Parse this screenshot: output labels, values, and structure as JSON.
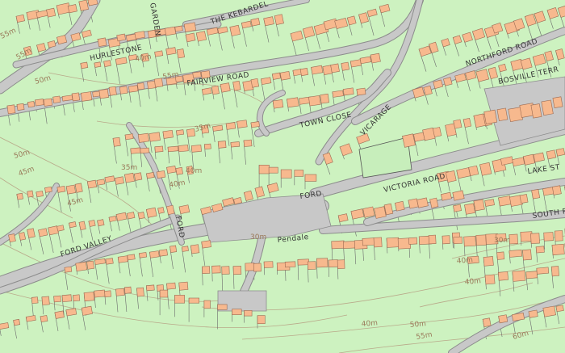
{
  "map": {
    "colors": {
      "land": "#cdf2c0",
      "road": "#c8c8c8",
      "road_edge": "#8c8c8c",
      "building": "#f7b98e",
      "plot_line": "#6b6b6b",
      "contour": "#b9a98a",
      "label": "#333333"
    },
    "street_labels": [
      "THE  KEBARDEL",
      "GARDEN",
      "HURLESTONE",
      "FAIRVIEW ROAD",
      "TOWN  CLOSE",
      "VICARAGE",
      "NORTHFORD ROAD",
      "BOSVILLE TERR",
      "VICTORIA ROAD",
      "LAKE ST",
      "SOUTH RD",
      "FORD",
      "FORD",
      "FORD  VALLEY",
      "Pendale"
    ],
    "contour_labels": [
      "55m",
      "55m",
      "50m",
      "40m",
      "55m",
      "35m",
      "50m",
      "45m",
      "40m",
      "30m",
      "40m",
      "40m",
      "30m",
      "40m",
      "50m",
      "55m",
      "60m",
      "45m",
      "40m",
      "35m"
    ]
  }
}
